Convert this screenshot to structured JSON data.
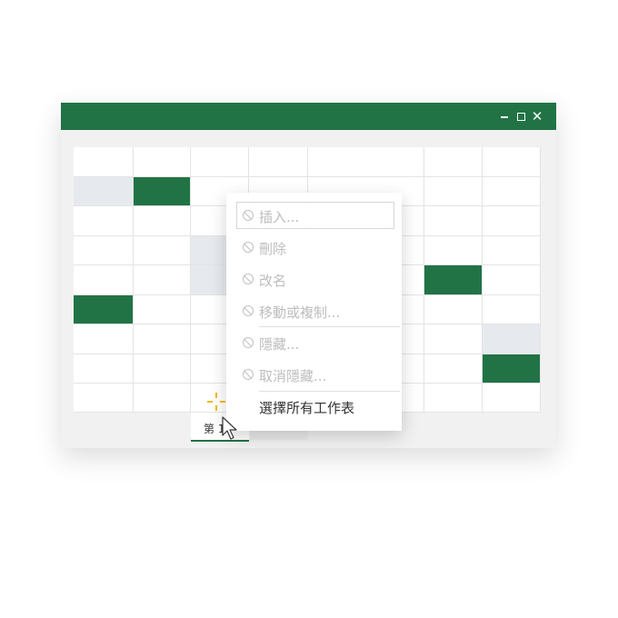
{
  "colors": {
    "accent": "#217346",
    "light_cell": "#e6eaef",
    "sparkle": "#f5b800"
  },
  "window": {
    "controls": [
      "minimize-icon",
      "maximize-icon",
      "close-icon"
    ]
  },
  "sheet_tab": {
    "label": "第 1"
  },
  "context_menu": {
    "items": [
      {
        "label": "插入...",
        "disabled": true,
        "icon": "ban-icon"
      },
      {
        "label": "刪除",
        "disabled": true,
        "icon": "ban-icon"
      },
      {
        "label": "改名",
        "disabled": true,
        "icon": "ban-icon"
      },
      {
        "label": "移動或複制...",
        "disabled": true,
        "icon": "ban-icon"
      },
      {
        "label": "隱藏...",
        "disabled": true,
        "icon": "ban-icon"
      },
      {
        "label": "取消隱藏...",
        "disabled": true,
        "icon": "ban-icon"
      },
      {
        "label": "選擇所有工作表",
        "disabled": false
      }
    ]
  }
}
